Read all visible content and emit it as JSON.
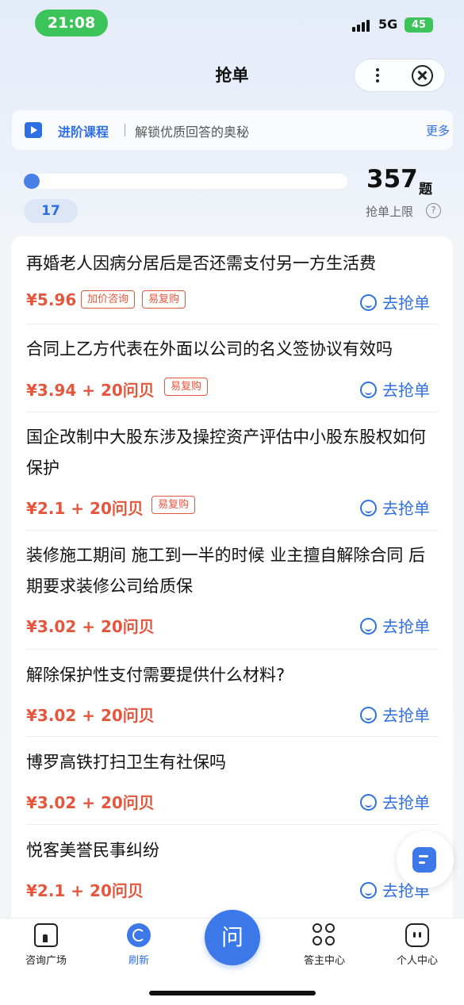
{
  "status_bar": {
    "time": "21:08",
    "network": "5G",
    "battery": "45"
  },
  "header": {
    "title": "抢单"
  },
  "banner": {
    "course_label": "进阶课程",
    "description": "解锁优质回答的奥秘",
    "more_label": "更多"
  },
  "progress": {
    "current": "17",
    "limit": "357",
    "limit_unit": "题",
    "limit_label": "抢单上限",
    "fill_fraction": 0.048,
    "help_glyph": "?"
  },
  "grab_label": "去抢单",
  "orders": [
    {
      "question": "再婚老人因病分居后是否还需支付另一方生活费",
      "price": "¥5.96",
      "tags": [
        "加价咨询",
        "易复购"
      ]
    },
    {
      "question": "合同上乙方代表在外面以公司的名义签协议有效吗",
      "price": "¥3.94 + 20问贝",
      "tags": [
        "易复购"
      ]
    },
    {
      "question": "国企改制中大股东涉及操控资产评估中小股东股权如何保护",
      "price": "¥2.1 + 20问贝",
      "tags": [
        "易复购"
      ]
    },
    {
      "question": "装修施工期间 施工到一半的时候 业主擅自解除合同 后期要求装修公司给质保",
      "price": "¥3.02 + 20问贝",
      "tags": []
    },
    {
      "question": "解除保护性支付需要提供什么材料?",
      "price": "¥3.02 + 20问贝",
      "tags": []
    },
    {
      "question": "博罗高铁打扫卫生有社保吗",
      "price": "¥3.02 + 20问贝",
      "tags": []
    },
    {
      "question": "悦客美誉民事纠纷",
      "price": "¥2.1 + 20问贝",
      "tags": []
    }
  ],
  "tabbar": {
    "consult": "咨询广场",
    "refresh": "刷新",
    "ask": "问",
    "answerer": "答主中心",
    "mine": "个人中心"
  },
  "colors": {
    "accent": "#2f6fe4",
    "price": "#e4573e",
    "status_green": "#3cc45a"
  }
}
